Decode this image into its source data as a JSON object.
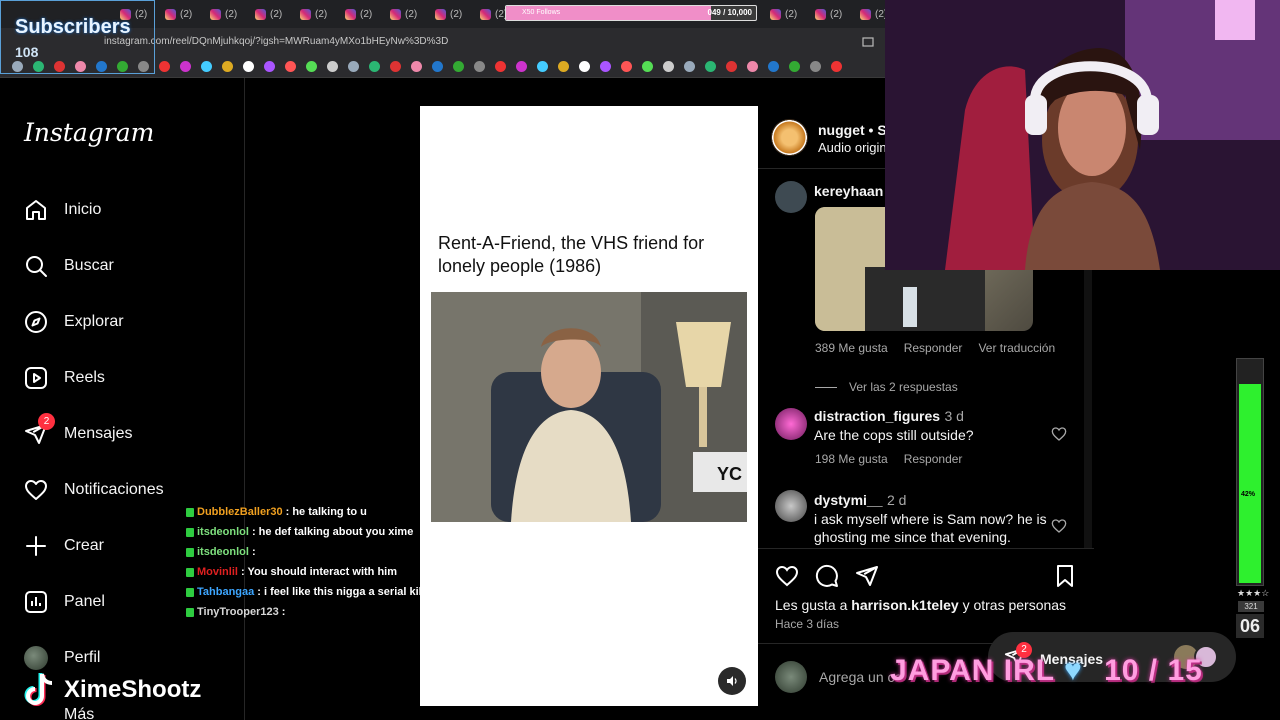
{
  "browser": {
    "tab_count_label": "(2)",
    "url": "instagram.com/reel/DQnMjuhkqoj/?igsh=MWRuam4yMXo1bHEyNw%3D%3D",
    "follow_goal": {
      "label": "X50 Follows",
      "count_text": "049 / 10,000",
      "progress": 0.82
    }
  },
  "subscribers": {
    "title": "Subscribers",
    "count": "108"
  },
  "instagram": {
    "logo": "Instagram",
    "nav": [
      {
        "label": "Inicio",
        "icon": "home-icon"
      },
      {
        "label": "Buscar",
        "icon": "search-icon"
      },
      {
        "label": "Explorar",
        "icon": "compass-icon"
      },
      {
        "label": "Reels",
        "icon": "reels-icon"
      },
      {
        "label": "Mensajes",
        "icon": "messenger-icon",
        "badge": "2"
      },
      {
        "label": "Notificaciones",
        "icon": "heart-icon"
      },
      {
        "label": "Crear",
        "icon": "plus-icon"
      },
      {
        "label": "Panel",
        "icon": "chart-icon"
      },
      {
        "label": "Perfil",
        "icon": "avatar"
      },
      {
        "label": "Más",
        "icon": "menu-icon"
      }
    ]
  },
  "reel": {
    "title": "Rent-A-Friend, the VHS friend for lonely people (1986)",
    "video_plate": "YC"
  },
  "post": {
    "author": "nugget • S",
    "audio": "Audio origin",
    "comments": [
      {
        "user": "kereyhaan",
        "likes": "389 Me gusta",
        "reply": "Responder",
        "translate": "Ver traducción",
        "view_replies": "Ver las 2 respuestas"
      },
      {
        "user": "distraction_figures",
        "time": "3 d",
        "text": "Are the cops still outside?",
        "likes": "198 Me gusta",
        "reply": "Responder"
      },
      {
        "user": "dystymi__",
        "time": "2 d",
        "text": "i ask myself where is Sam now? he is ghosting me since that evening."
      }
    ],
    "liked_by_prefix": "Les gusta a",
    "liked_by_user": "harrison.k1teley",
    "liked_by_suffix": "y otras personas",
    "posted": "Hace 3 días",
    "comment_placeholder": "Agrega un co"
  },
  "messages_pill": {
    "label": "Mensajes",
    "badge": "2"
  },
  "chat": [
    {
      "user": "DubblezBaller30",
      "color": "#f0a020",
      "text": ": he talking to u"
    },
    {
      "user": "itsdeonlol",
      "color": "#7ee07e",
      "text": ": he def talking about you xime"
    },
    {
      "user": "itsdeonlol",
      "color": "#7ee07e",
      "text": ":"
    },
    {
      "user": "Movinlil",
      "color": "#e02020",
      "text": ": You should interact with him"
    },
    {
      "user": "Tahbangaa",
      "color": "#3da6ff",
      "text": ": i feel like this nigga a serial killer"
    },
    {
      "user": "TinyTrooper123",
      "color": "#d7d7d7",
      "text": ":"
    }
  ],
  "hud": {
    "meter_label": "42%",
    "meter_level": 0.88,
    "small_num": "321",
    "big_num": "06"
  },
  "stream": {
    "name": "XimeShootz",
    "event": "JAPAN IRL",
    "event_progress": "10 / 15",
    "colors": {
      "accent": "#ff9ee0",
      "meter": "#2ef02e",
      "badge": "#ff3040"
    }
  }
}
